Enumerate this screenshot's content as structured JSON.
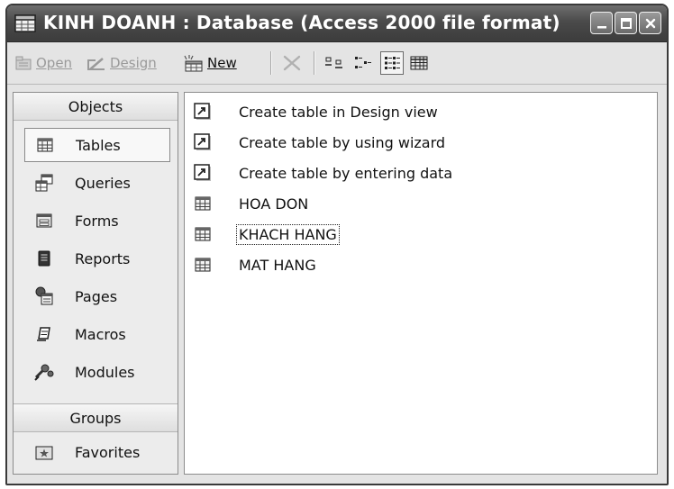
{
  "window": {
    "title": "KINH DOANH : Database (Access 2000 file format)"
  },
  "toolbar": {
    "open_label": "Open",
    "design_label": "Design",
    "new_label": "New"
  },
  "sidebar": {
    "objects_header": "Objects",
    "groups_header": "Groups",
    "items": [
      {
        "label": "Tables",
        "icon": "table-icon"
      },
      {
        "label": "Queries",
        "icon": "query-icon"
      },
      {
        "label": "Forms",
        "icon": "form-icon"
      },
      {
        "label": "Reports",
        "icon": "report-icon"
      },
      {
        "label": "Pages",
        "icon": "page-icon"
      },
      {
        "label": "Macros",
        "icon": "macro-icon"
      },
      {
        "label": "Modules",
        "icon": "module-icon"
      }
    ],
    "favorites_label": "Favorites"
  },
  "list": {
    "items": [
      {
        "label": "Create table in Design view",
        "icon": "shortcut-icon"
      },
      {
        "label": "Create table by using wizard",
        "icon": "shortcut-icon"
      },
      {
        "label": "Create table by entering data",
        "icon": "shortcut-icon"
      },
      {
        "label": "HOA DON",
        "icon": "table-icon"
      },
      {
        "label": "KHACH HANG",
        "icon": "table-icon"
      },
      {
        "label": "MAT HANG",
        "icon": "table-icon"
      }
    ]
  },
  "colors": {
    "titlebar": "#4a4a4a",
    "window_bg": "#e4e4e4",
    "pane_bg": "#ffffff"
  }
}
